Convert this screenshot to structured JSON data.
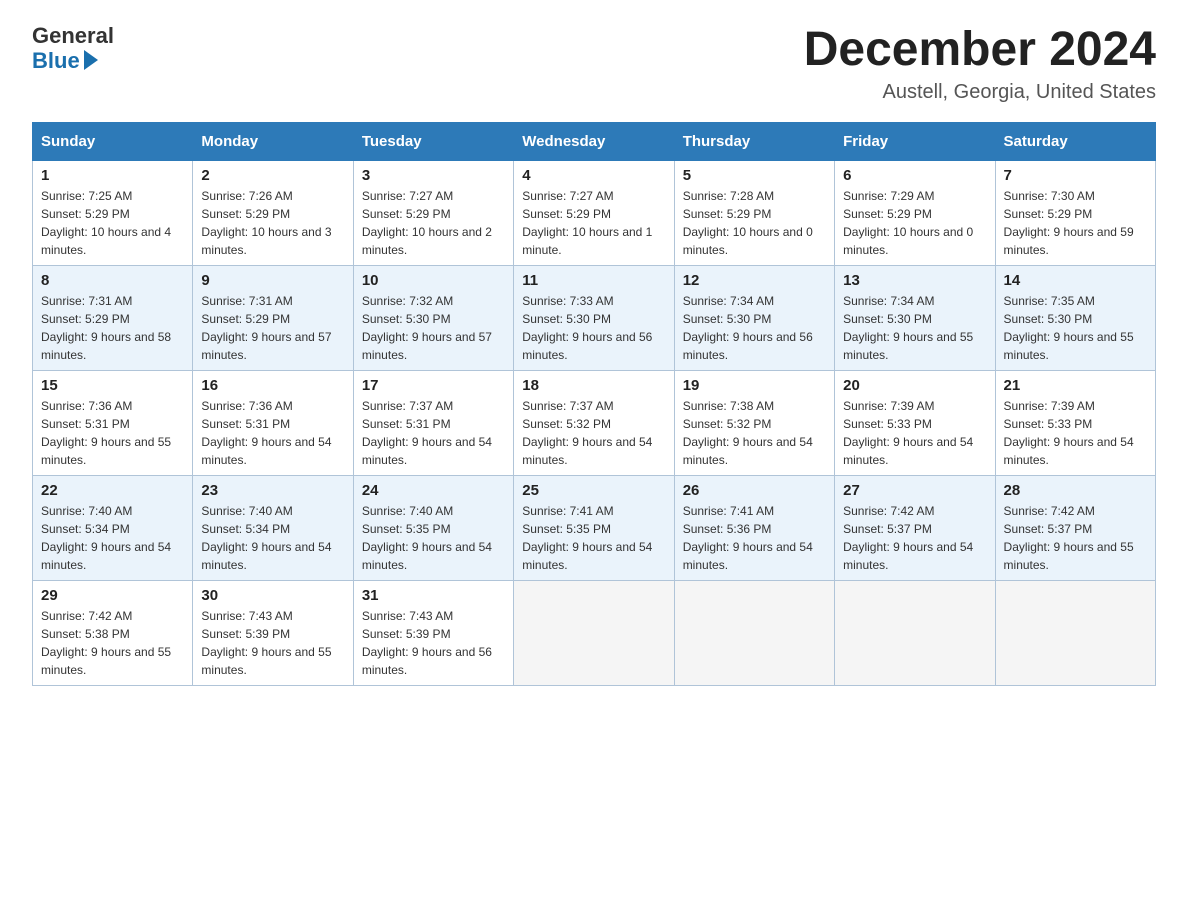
{
  "header": {
    "logo_general": "General",
    "logo_blue": "Blue",
    "month_title": "December 2024",
    "location": "Austell, Georgia, United States"
  },
  "days_of_week": [
    "Sunday",
    "Monday",
    "Tuesday",
    "Wednesday",
    "Thursday",
    "Friday",
    "Saturday"
  ],
  "weeks": [
    [
      {
        "day": "1",
        "sunrise": "7:25 AM",
        "sunset": "5:29 PM",
        "daylight": "10 hours and 4 minutes."
      },
      {
        "day": "2",
        "sunrise": "7:26 AM",
        "sunset": "5:29 PM",
        "daylight": "10 hours and 3 minutes."
      },
      {
        "day": "3",
        "sunrise": "7:27 AM",
        "sunset": "5:29 PM",
        "daylight": "10 hours and 2 minutes."
      },
      {
        "day": "4",
        "sunrise": "7:27 AM",
        "sunset": "5:29 PM",
        "daylight": "10 hours and 1 minute."
      },
      {
        "day": "5",
        "sunrise": "7:28 AM",
        "sunset": "5:29 PM",
        "daylight": "10 hours and 0 minutes."
      },
      {
        "day": "6",
        "sunrise": "7:29 AM",
        "sunset": "5:29 PM",
        "daylight": "10 hours and 0 minutes."
      },
      {
        "day": "7",
        "sunrise": "7:30 AM",
        "sunset": "5:29 PM",
        "daylight": "9 hours and 59 minutes."
      }
    ],
    [
      {
        "day": "8",
        "sunrise": "7:31 AM",
        "sunset": "5:29 PM",
        "daylight": "9 hours and 58 minutes."
      },
      {
        "day": "9",
        "sunrise": "7:31 AM",
        "sunset": "5:29 PM",
        "daylight": "9 hours and 57 minutes."
      },
      {
        "day": "10",
        "sunrise": "7:32 AM",
        "sunset": "5:30 PM",
        "daylight": "9 hours and 57 minutes."
      },
      {
        "day": "11",
        "sunrise": "7:33 AM",
        "sunset": "5:30 PM",
        "daylight": "9 hours and 56 minutes."
      },
      {
        "day": "12",
        "sunrise": "7:34 AM",
        "sunset": "5:30 PM",
        "daylight": "9 hours and 56 minutes."
      },
      {
        "day": "13",
        "sunrise": "7:34 AM",
        "sunset": "5:30 PM",
        "daylight": "9 hours and 55 minutes."
      },
      {
        "day": "14",
        "sunrise": "7:35 AM",
        "sunset": "5:30 PM",
        "daylight": "9 hours and 55 minutes."
      }
    ],
    [
      {
        "day": "15",
        "sunrise": "7:36 AM",
        "sunset": "5:31 PM",
        "daylight": "9 hours and 55 minutes."
      },
      {
        "day": "16",
        "sunrise": "7:36 AM",
        "sunset": "5:31 PM",
        "daylight": "9 hours and 54 minutes."
      },
      {
        "day": "17",
        "sunrise": "7:37 AM",
        "sunset": "5:31 PM",
        "daylight": "9 hours and 54 minutes."
      },
      {
        "day": "18",
        "sunrise": "7:37 AM",
        "sunset": "5:32 PM",
        "daylight": "9 hours and 54 minutes."
      },
      {
        "day": "19",
        "sunrise": "7:38 AM",
        "sunset": "5:32 PM",
        "daylight": "9 hours and 54 minutes."
      },
      {
        "day": "20",
        "sunrise": "7:39 AM",
        "sunset": "5:33 PM",
        "daylight": "9 hours and 54 minutes."
      },
      {
        "day": "21",
        "sunrise": "7:39 AM",
        "sunset": "5:33 PM",
        "daylight": "9 hours and 54 minutes."
      }
    ],
    [
      {
        "day": "22",
        "sunrise": "7:40 AM",
        "sunset": "5:34 PM",
        "daylight": "9 hours and 54 minutes."
      },
      {
        "day": "23",
        "sunrise": "7:40 AM",
        "sunset": "5:34 PM",
        "daylight": "9 hours and 54 minutes."
      },
      {
        "day": "24",
        "sunrise": "7:40 AM",
        "sunset": "5:35 PM",
        "daylight": "9 hours and 54 minutes."
      },
      {
        "day": "25",
        "sunrise": "7:41 AM",
        "sunset": "5:35 PM",
        "daylight": "9 hours and 54 minutes."
      },
      {
        "day": "26",
        "sunrise": "7:41 AM",
        "sunset": "5:36 PM",
        "daylight": "9 hours and 54 minutes."
      },
      {
        "day": "27",
        "sunrise": "7:42 AM",
        "sunset": "5:37 PM",
        "daylight": "9 hours and 54 minutes."
      },
      {
        "day": "28",
        "sunrise": "7:42 AM",
        "sunset": "5:37 PM",
        "daylight": "9 hours and 55 minutes."
      }
    ],
    [
      {
        "day": "29",
        "sunrise": "7:42 AM",
        "sunset": "5:38 PM",
        "daylight": "9 hours and 55 minutes."
      },
      {
        "day": "30",
        "sunrise": "7:43 AM",
        "sunset": "5:39 PM",
        "daylight": "9 hours and 55 minutes."
      },
      {
        "day": "31",
        "sunrise": "7:43 AM",
        "sunset": "5:39 PM",
        "daylight": "9 hours and 56 minutes."
      },
      null,
      null,
      null,
      null
    ]
  ],
  "labels": {
    "sunrise_prefix": "Sunrise: ",
    "sunset_prefix": "Sunset: ",
    "daylight_prefix": "Daylight: "
  }
}
